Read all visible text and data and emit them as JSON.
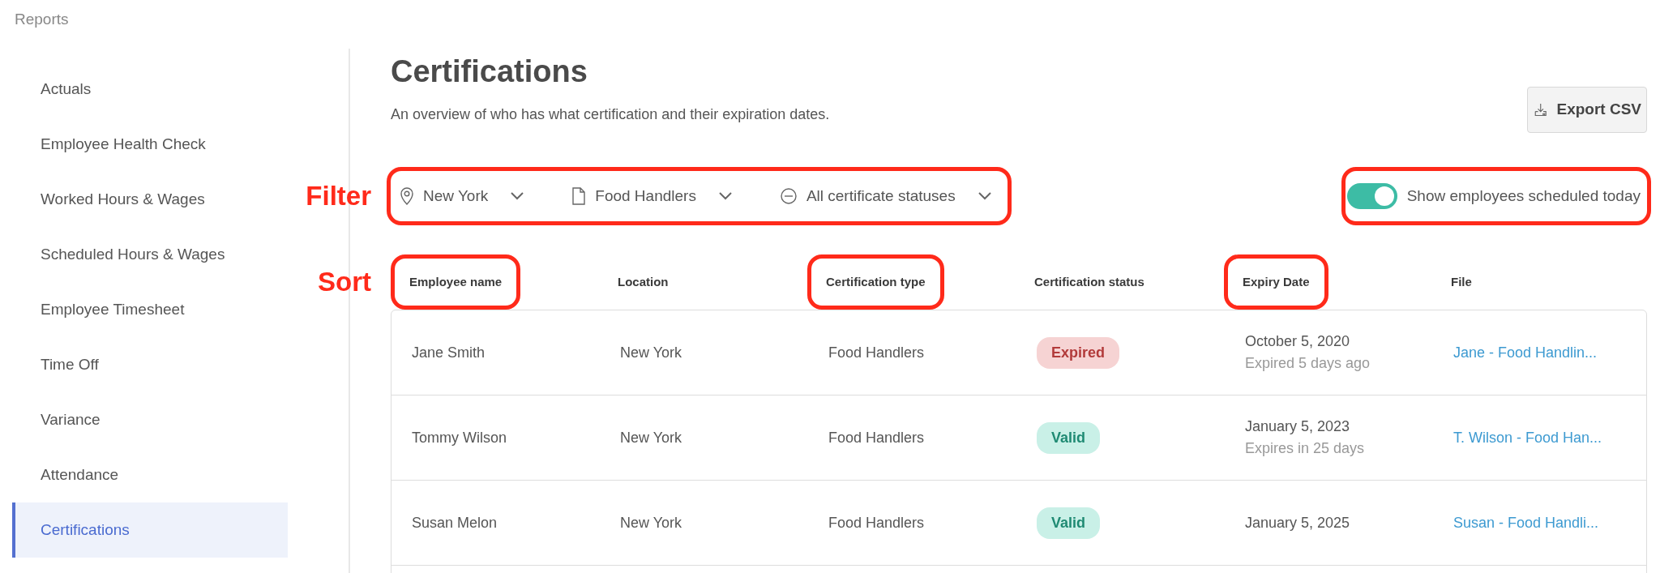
{
  "breadcrumb": "Reports",
  "sidebar": {
    "items": [
      {
        "label": "Actuals",
        "selected": false
      },
      {
        "label": "Employee Health Check",
        "selected": false
      },
      {
        "label": "Worked Hours & Wages",
        "selected": false
      },
      {
        "label": "Scheduled Hours & Wages",
        "selected": false
      },
      {
        "label": "Employee Timesheet",
        "selected": false
      },
      {
        "label": "Time Off",
        "selected": false
      },
      {
        "label": "Variance",
        "selected": false
      },
      {
        "label": "Attendance",
        "selected": false
      },
      {
        "label": "Certifications",
        "selected": true
      }
    ]
  },
  "page": {
    "title": "Certifications",
    "subtitle": "An overview of who has what certification and their expiration dates.",
    "export_button": "Export CSV"
  },
  "filters": {
    "annotation": "Filter",
    "highlighted": true,
    "items": [
      {
        "kind": "location",
        "label": "New York"
      },
      {
        "kind": "document",
        "label": "Food Handlers"
      },
      {
        "kind": "status",
        "label": "All certificate statuses"
      }
    ]
  },
  "toggle": {
    "label": "Show employees scheduled today",
    "on": true,
    "highlighted": true
  },
  "table": {
    "sort_annotation": "Sort",
    "columns": [
      {
        "label": "Employee name",
        "highlighted": true
      },
      {
        "label": "Location",
        "highlighted": false
      },
      {
        "label": "Certification type",
        "highlighted": true
      },
      {
        "label": "Certification status",
        "highlighted": false
      },
      {
        "label": "Expiry Date",
        "highlighted": true
      },
      {
        "label": "File",
        "highlighted": false
      }
    ],
    "rows": [
      {
        "name": "Jane Smith",
        "location": "New York",
        "certification_type": "Food Handlers",
        "status": {
          "kind": "expired",
          "label": "Expired"
        },
        "expiry_date": "October 5, 2020",
        "expiry_note": "Expired 5 days ago",
        "file": "Jane - Food Handlin..."
      },
      {
        "name": "Tommy Wilson",
        "location": "New York",
        "certification_type": "Food Handlers",
        "status": {
          "kind": "valid",
          "label": "Valid"
        },
        "expiry_date": "January 5, 2023",
        "expiry_note": "Expires in 25 days",
        "file": "T. Wilson - Food Han..."
      },
      {
        "name": "Susan Melon",
        "location": "New York",
        "certification_type": "Food Handlers",
        "status": {
          "kind": "valid",
          "label": "Valid"
        },
        "expiry_date": "January 5, 2025",
        "file": "Susan - Food Handli..."
      }
    ]
  }
}
